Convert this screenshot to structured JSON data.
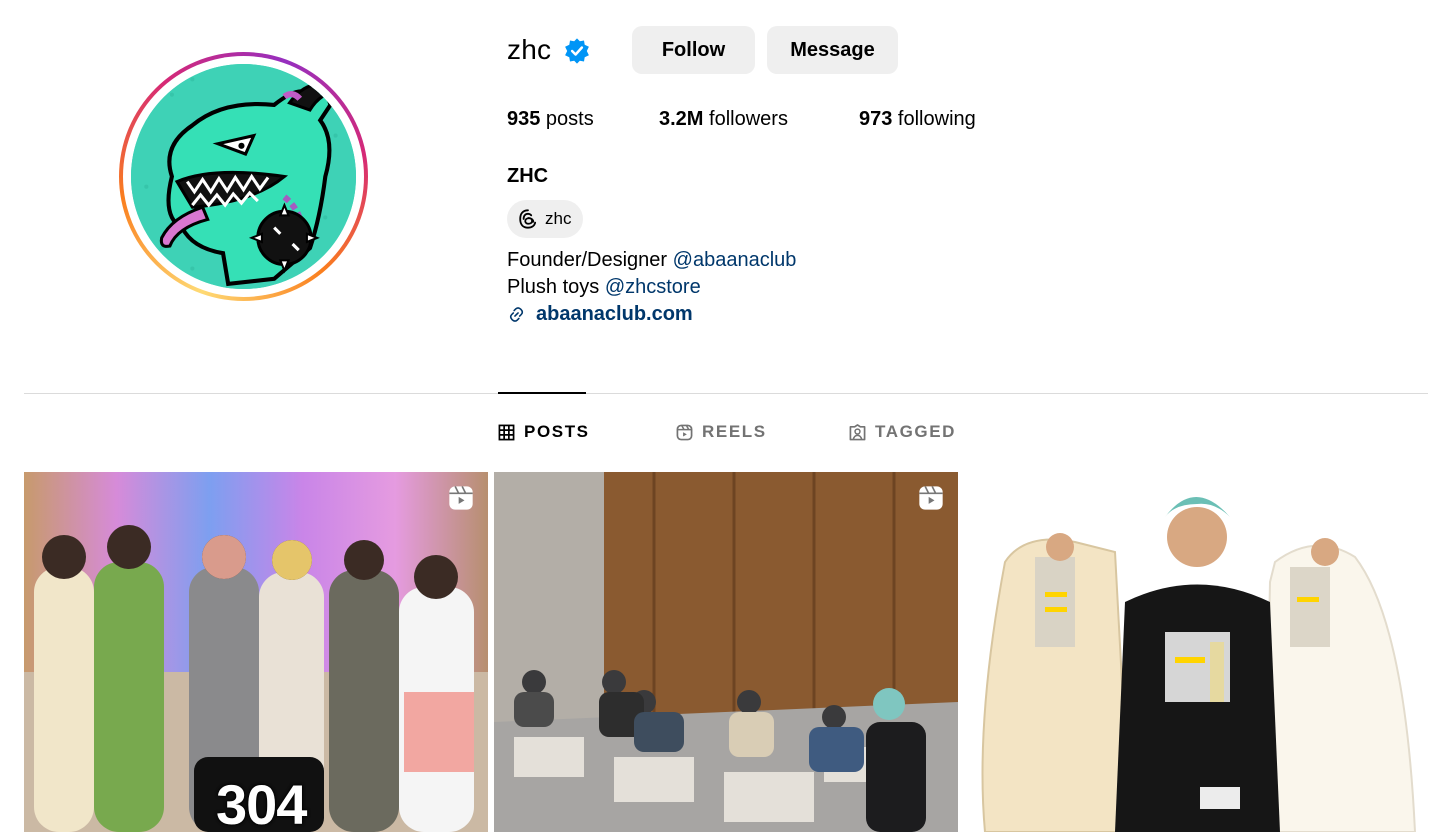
{
  "profile": {
    "username": "zhc",
    "verified": true,
    "follow_label": "Follow",
    "message_label": "Message",
    "stats": {
      "posts_count": "935",
      "posts_label": " posts",
      "followers_count": "3.2M",
      "followers_label": " followers",
      "following_count": "973",
      "following_label": " following"
    },
    "full_name": "ZHC",
    "threads_handle": "zhc",
    "bio": {
      "line1_text": "Founder/Designer ",
      "line1_mention": "@abaanaclub",
      "line2_text": "Plush toys ",
      "line2_mention": "@zhcstore"
    },
    "link": "abaanaclub.com"
  },
  "tabs": [
    {
      "label": "POSTS",
      "icon": "grid-icon",
      "active": true
    },
    {
      "label": "REELS",
      "icon": "reels-icon",
      "active": false
    },
    {
      "label": "TAGGED",
      "icon": "tagged-icon",
      "active": false
    }
  ],
  "posts": [
    {
      "type": "reel",
      "overlay_text": "304"
    },
    {
      "type": "reel"
    },
    {
      "type": "photo"
    }
  ],
  "colors": {
    "verified": "#0095f6",
    "button_bg": "#efefef",
    "link": "#00376b",
    "divider": "#dbdbdb",
    "muted": "#737373"
  }
}
